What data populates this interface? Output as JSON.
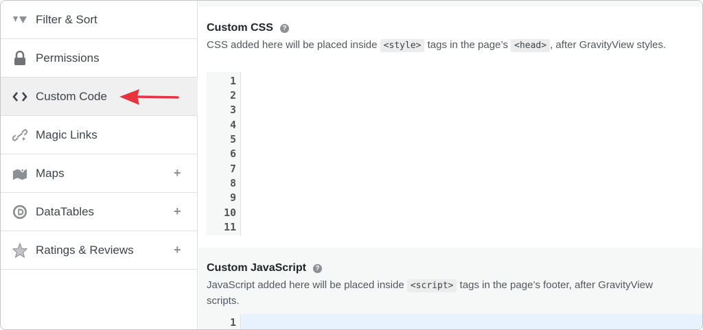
{
  "sidebar": {
    "items": [
      {
        "label": "Filter & Sort",
        "icon": "filter-icon",
        "expandable": false
      },
      {
        "label": "Permissions",
        "icon": "lock-icon",
        "expandable": false
      },
      {
        "label": "Custom Code",
        "icon": "code-brackets-icon",
        "expandable": false,
        "active": true
      },
      {
        "label": "Magic Links",
        "icon": "magic-link-icon",
        "expandable": false
      },
      {
        "label": "Maps",
        "icon": "map-icon",
        "expandable": true
      },
      {
        "label": "DataTables",
        "icon": "datatables-icon",
        "expandable": true
      },
      {
        "label": "Ratings & Reviews",
        "icon": "star-icon",
        "expandable": true
      }
    ],
    "plus_symbol": "+"
  },
  "custom_css": {
    "title": "Custom CSS",
    "desc_before": "CSS added here will be placed inside",
    "tag1": "<style>",
    "desc_middle": "tags in the page’s",
    "tag2": "<head>",
    "desc_after": ", after GravityView styles.",
    "line_numbers": [
      "1",
      "2",
      "3",
      "4",
      "5",
      "6",
      "7",
      "8",
      "9",
      "10",
      "11"
    ]
  },
  "custom_js": {
    "title": "Custom JavaScript",
    "desc_before": "JavaScript added here will be placed inside",
    "tag1": "<script>",
    "desc_after": "tags in the page’s footer, after GravityView scripts.",
    "line_numbers": [
      "1"
    ]
  },
  "colors": {
    "accent_arrow": "#e8333c",
    "active_bg": "#f0f0f1"
  },
  "help_symbol": "?"
}
